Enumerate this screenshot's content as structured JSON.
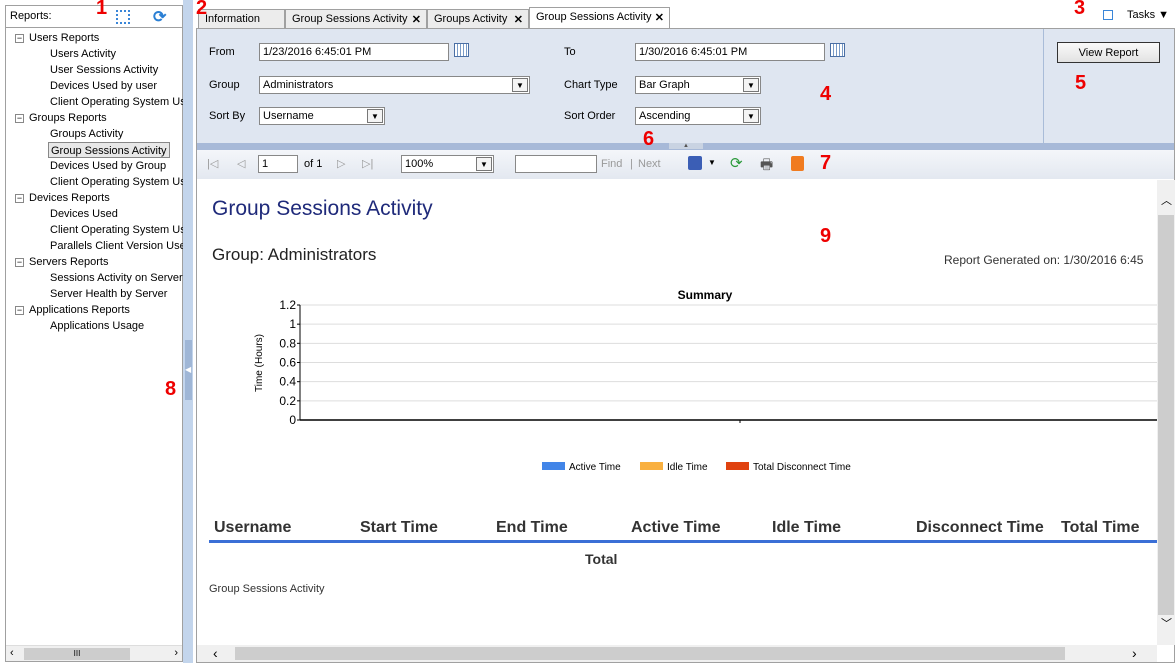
{
  "sidebar": {
    "title": "Reports:",
    "groups": [
      {
        "label": "Users Reports",
        "items": [
          "Users Activity",
          "User Sessions Activity",
          "Devices Used by user",
          "Client Operating System Use"
        ]
      },
      {
        "label": "Groups Reports",
        "items": [
          "Groups Activity",
          "Group Sessions Activity",
          "Devices Used by Group",
          "Client Operating System Use"
        ]
      },
      {
        "label": "Devices Reports",
        "items": [
          "Devices Used",
          "Client Operating System Use",
          "Parallels Client Version Used"
        ]
      },
      {
        "label": "Servers Reports",
        "items": [
          "Sessions Activity on Server",
          "Server Health by Server"
        ]
      },
      {
        "label": "Applications Reports",
        "items": [
          "Applications Usage"
        ]
      }
    ],
    "selected": "Group Sessions Activity"
  },
  "tabs": [
    {
      "label": "Information",
      "closable": false
    },
    {
      "label": "Group Sessions Activity",
      "closable": true
    },
    {
      "label": "Groups Activity",
      "closable": true
    },
    {
      "label": "Group Sessions Activity",
      "closable": true,
      "active": true
    }
  ],
  "tasks_label": "Tasks",
  "params": {
    "from_label": "From",
    "from_value": "1/23/2016 6:45:01 PM",
    "to_label": "To",
    "to_value": "1/30/2016 6:45:01 PM",
    "group_label": "Group",
    "group_value": "Administrators",
    "chart_type_label": "Chart Type",
    "chart_type_value": "Bar Graph",
    "sort_by_label": "Sort By",
    "sort_by_value": "Username",
    "sort_order_label": "Sort Order",
    "sort_order_value": "Ascending",
    "view_report": "View Report"
  },
  "toolbar": {
    "page": "1",
    "of": "of 1",
    "zoom": "100%",
    "find_value": "",
    "find": "Find",
    "sep": "|",
    "next": "Next"
  },
  "report": {
    "title": "Group Sessions Activity",
    "group": "Group: Administrators",
    "generated": "Report Generated on: 1/30/2016 6:45",
    "chart_title": "Summary",
    "columns": [
      "Username",
      "Start Time",
      "End Time",
      "Active Time",
      "Idle Time",
      "Disconnect Time",
      "Total Time"
    ],
    "total": "Total",
    "footer": "Group Sessions Activity"
  },
  "chart_data": {
    "type": "bar",
    "title": "Summary",
    "ylabel": "Time (Hours)",
    "xlabel": "",
    "ylim": [
      0,
      1.2
    ],
    "yticks": [
      "0",
      "0.2",
      "0.4",
      "0.6",
      "0.8",
      "1",
      "1.2"
    ],
    "grid": true,
    "legend_position": "bottom",
    "series": [
      {
        "name": "Active Time",
        "color": "#4285e8",
        "values": []
      },
      {
        "name": "Idle Time",
        "color": "#f9b040",
        "values": []
      },
      {
        "name": "Total Disconnect Time",
        "color": "#e0420f",
        "values": []
      }
    ]
  },
  "annotations": [
    "1",
    "2",
    "3",
    "4",
    "5",
    "6",
    "7",
    "8",
    "9"
  ]
}
